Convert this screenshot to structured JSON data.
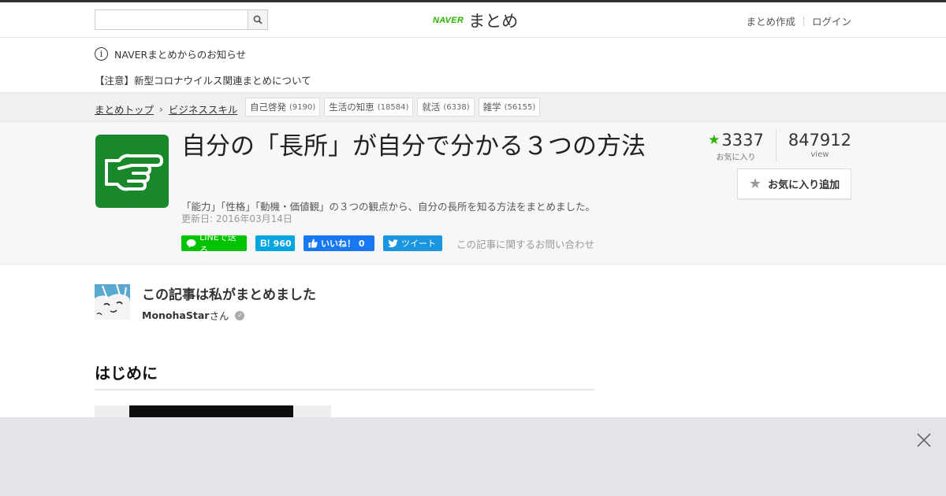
{
  "header": {
    "search_placeholder": "",
    "logo_naver": "NAVER",
    "logo_matome": "まとめ",
    "create_link": "まとめ作成",
    "login_link": "ログイン"
  },
  "notice": {
    "title": "NAVERまとめからのお知らせ",
    "item": "【注意】新型コロナウイルス関連まとめについて"
  },
  "breadcrumb": {
    "top": "まとめトップ",
    "category": "ビジネススキル"
  },
  "tags": [
    {
      "label": "自己啓発",
      "count": "(9190)"
    },
    {
      "label": "生活の知恵",
      "count": "(18584)"
    },
    {
      "label": "就活",
      "count": "(6338)"
    },
    {
      "label": "雑学",
      "count": "(56155)"
    }
  ],
  "article": {
    "title": "自分の「長所」が自分で分かる３つの方法",
    "description": "「能力」「性格」「動機・価値観」の３つの観点から、自分の長所を知る方法をまとめました。",
    "updated": "更新日: 2016年03月14日"
  },
  "share": {
    "line": "LINEで送る",
    "hatena": "960",
    "facebook": "いいね！ 0",
    "twitter": "ツイート",
    "contact": "この記事に関するお問い合わせ"
  },
  "stats": {
    "favorites": "3337",
    "favorites_label": "お気に入り",
    "views": "847912",
    "views_label": "view",
    "add_favorite": "お気に入り追加"
  },
  "author": {
    "heading": "この記事は私がまとめました",
    "name": "MonohaStar",
    "suffix": "さん"
  },
  "content": {
    "section_heading": "はじめに"
  },
  "colors": {
    "brand_green": "#2db400",
    "thumb_green": "#19882a",
    "line_green": "#00c300",
    "hatena_blue": "#00a4de",
    "facebook_blue": "#1877f2",
    "twitter_blue": "#1b95e0"
  },
  "icons": [
    "search-icon",
    "info-icon",
    "chevron-right-icon",
    "pointing-hand-icon",
    "line-icon",
    "hatena-icon",
    "like-icon",
    "twitter-bird-icon",
    "star-icon",
    "verified-icon",
    "close-icon"
  ]
}
